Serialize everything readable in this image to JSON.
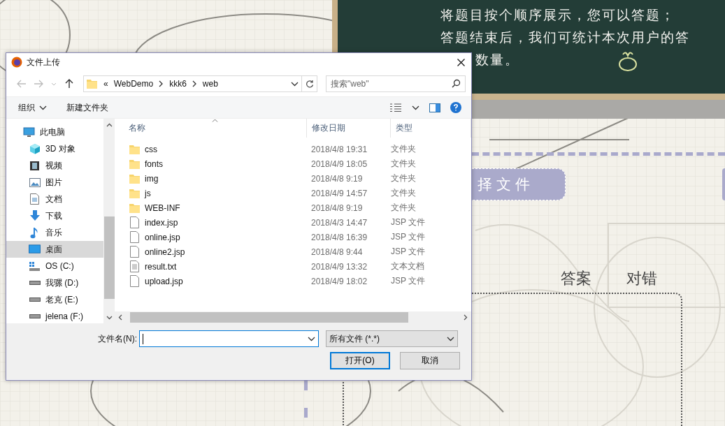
{
  "background": {
    "board_lines": [
      "将题目按个顺序展示，您可以答题；",
      "答题结束后，我们可统计本次用户的答",
      "数量。"
    ],
    "choose_button": "择文件",
    "answer_label": "答案",
    "result_label": "对错"
  },
  "dialog": {
    "title": "文件上传",
    "path_overflow": "«",
    "path": [
      "WebDemo",
      "kkk6",
      "web"
    ],
    "search": {
      "placeholder": "搜索\"web\""
    },
    "toolbar": [
      "组织",
      "新建文件夹"
    ],
    "sidebar": [
      {
        "label": "此电脑",
        "kind": "pc",
        "selected": false,
        "children": [
          {
            "label": "3D 对象",
            "kind": "cube",
            "selected": false
          },
          {
            "label": "视频",
            "kind": "video",
            "selected": false
          },
          {
            "label": "图片",
            "kind": "picture",
            "selected": false
          },
          {
            "label": "文档",
            "kind": "document",
            "selected": false
          },
          {
            "label": "下载",
            "kind": "download",
            "selected": false
          },
          {
            "label": "音乐",
            "kind": "music",
            "selected": false
          },
          {
            "label": "桌面",
            "kind": "desktop",
            "selected": true
          },
          {
            "label": "OS (C:)",
            "kind": "os-drive",
            "selected": false
          },
          {
            "label": "我骡 (D:)",
            "kind": "drive",
            "selected": false
          },
          {
            "label": "老克 (E:)",
            "kind": "drive",
            "selected": false
          },
          {
            "label": "jelena (F:)",
            "kind": "drive",
            "selected": false
          }
        ]
      }
    ],
    "columns": [
      "名称",
      "修改日期",
      "类型"
    ],
    "files": [
      {
        "name": "css",
        "date": "2018/4/8 19:31",
        "type": "文件夹",
        "kind": "folder"
      },
      {
        "name": "fonts",
        "date": "2018/4/9 18:05",
        "type": "文件夹",
        "kind": "folder"
      },
      {
        "name": "img",
        "date": "2018/4/8 9:19",
        "type": "文件夹",
        "kind": "folder"
      },
      {
        "name": "js",
        "date": "2018/4/9 14:57",
        "type": "文件夹",
        "kind": "folder"
      },
      {
        "name": "WEB-INF",
        "date": "2018/4/8 9:19",
        "type": "文件夹",
        "kind": "folder"
      },
      {
        "name": "index.jsp",
        "date": "2018/4/3 14:47",
        "type": "JSP 文件",
        "kind": "file"
      },
      {
        "name": "online.jsp",
        "date": "2018/4/8 16:39",
        "type": "JSP 文件",
        "kind": "file"
      },
      {
        "name": "online2.jsp",
        "date": "2018/4/8 9:44",
        "type": "JSP 文件",
        "kind": "file"
      },
      {
        "name": "result.txt",
        "date": "2018/4/9 13:32",
        "type": "文本文档",
        "kind": "text"
      },
      {
        "name": "upload.jsp",
        "date": "2018/4/9 18:02",
        "type": "JSP 文件",
        "kind": "file"
      }
    ],
    "filename_label": "文件名(N):",
    "filter": "所有文件 (*.*)",
    "buttons": [
      {
        "label": "打开(O)",
        "default": true
      },
      {
        "label": "取消",
        "default": false
      }
    ]
  }
}
